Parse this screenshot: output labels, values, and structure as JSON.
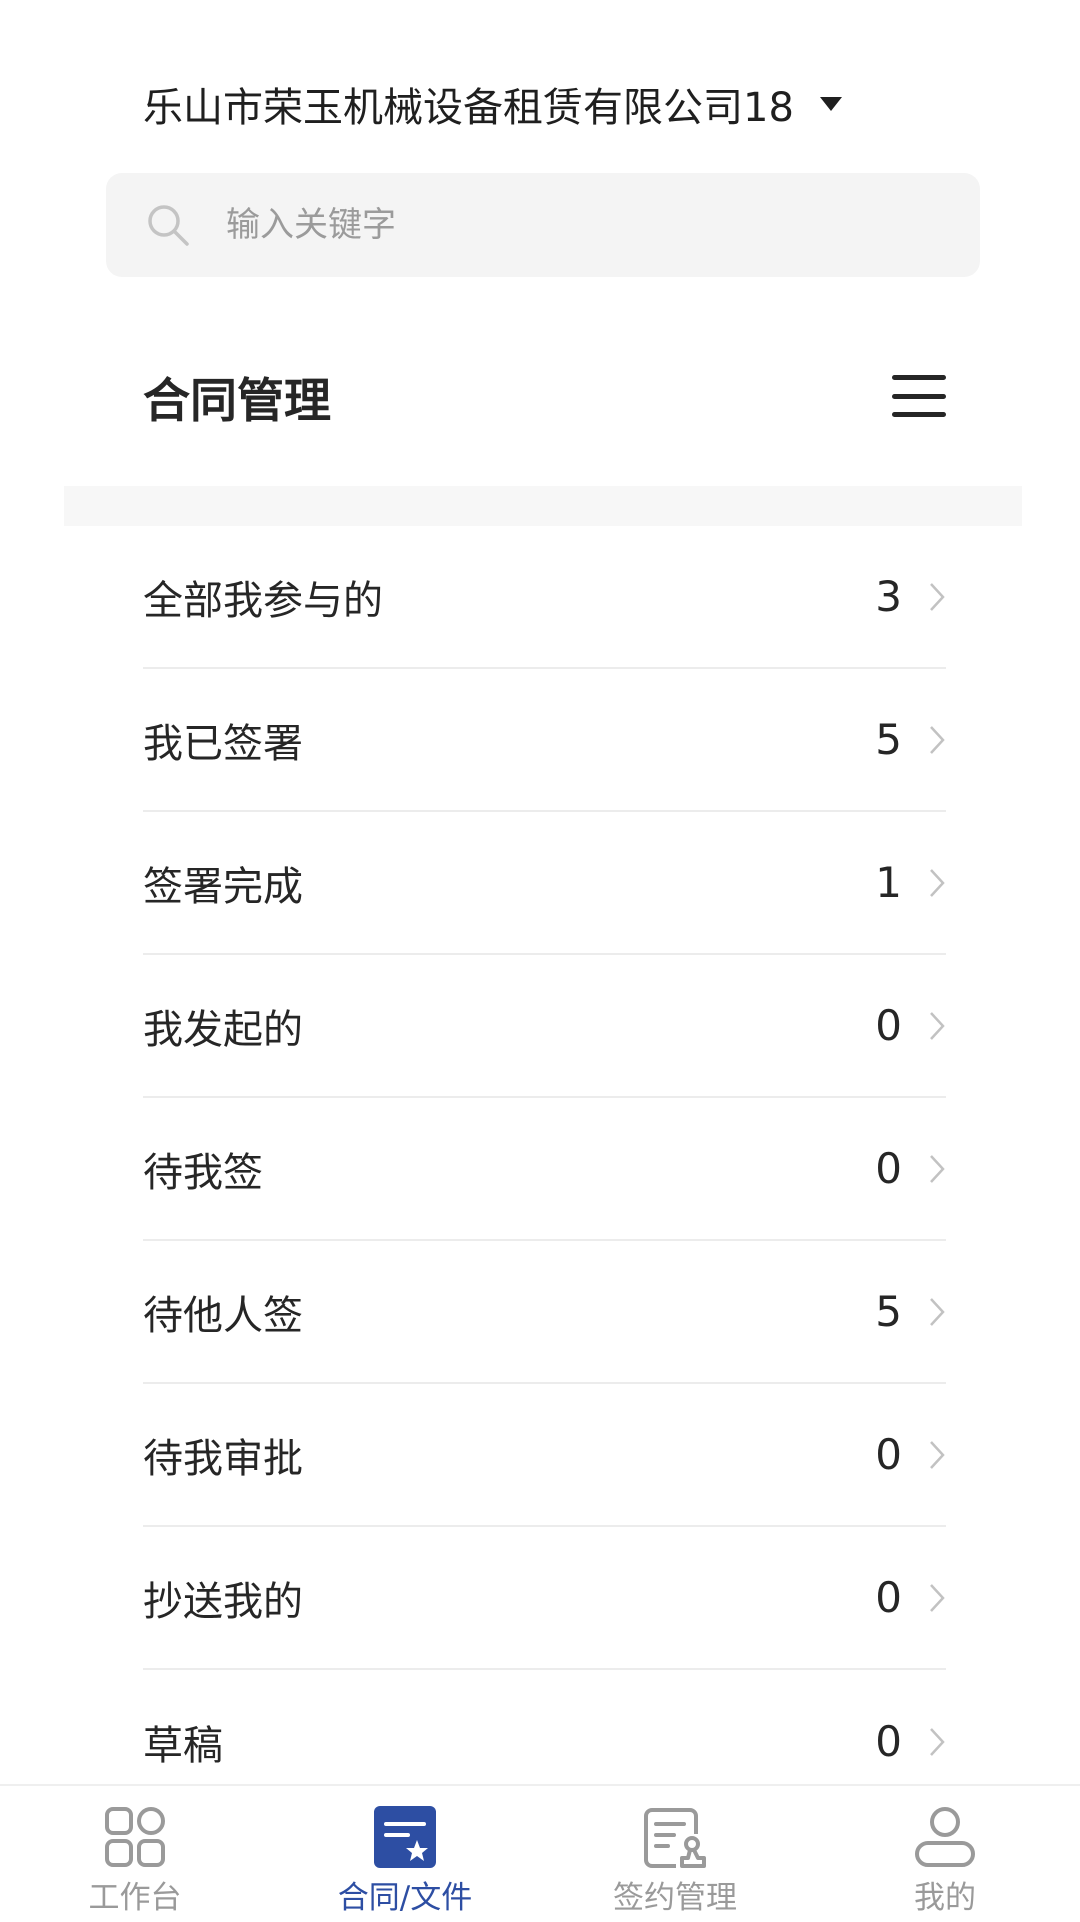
{
  "header": {
    "company_name": "乐山市荣玉机械设备租赁有限公司18"
  },
  "search": {
    "placeholder": "输入关键字"
  },
  "section": {
    "title": "合同管理"
  },
  "list": {
    "items": [
      {
        "label": "全部我参与的",
        "count": "3"
      },
      {
        "label": "我已签署",
        "count": "5"
      },
      {
        "label": "签署完成",
        "count": "1"
      },
      {
        "label": "我发起的",
        "count": "0"
      },
      {
        "label": "待我签",
        "count": "0"
      },
      {
        "label": "待他人签",
        "count": "5"
      },
      {
        "label": "待我审批",
        "count": "0"
      },
      {
        "label": "抄送我的",
        "count": "0"
      },
      {
        "label": "草稿",
        "count": "0"
      }
    ]
  },
  "tabs": [
    {
      "label": "工作台",
      "icon": "grid-icon",
      "active": false
    },
    {
      "label": "合同/文件",
      "icon": "contract-file-icon",
      "active": true
    },
    {
      "label": "签约管理",
      "icon": "sign-manage-icon",
      "active": false
    },
    {
      "label": "我的",
      "icon": "profile-icon",
      "active": false
    }
  ],
  "colors": {
    "accent": "#2d4ea3",
    "inactive": "#9a9a9a",
    "text": "#262626",
    "search_bg": "#f4f4f4"
  }
}
